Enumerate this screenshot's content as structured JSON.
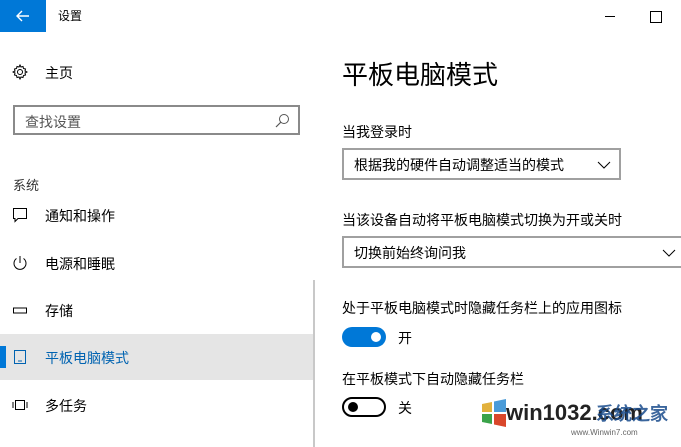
{
  "window": {
    "title": "设置",
    "back_icon": "arrow-left-icon",
    "accent": "#0078d7"
  },
  "sidebar": {
    "home_label": "主页",
    "search_placeholder": "查找设置",
    "section_label": "系统",
    "items": [
      {
        "label": "通知和操作",
        "icon": "notification-icon",
        "selected": false
      },
      {
        "label": "电源和睡眠",
        "icon": "power-icon",
        "selected": false
      },
      {
        "label": "存储",
        "icon": "storage-icon",
        "selected": false
      },
      {
        "label": "平板电脑模式",
        "icon": "tablet-mode-icon",
        "selected": true
      },
      {
        "label": "多任务",
        "icon": "multitasking-icon",
        "selected": false
      }
    ]
  },
  "main": {
    "title": "平板电脑模式",
    "signin_label": "当我登录时",
    "signin_value": "根据我的硬件自动调整适当的模式",
    "auto_switch_label": "当该设备自动将平板电脑模式切换为开或关时",
    "auto_switch_value": "切换前始终询问我",
    "hide_icons_label": "处于平板电脑模式时隐藏任务栏上的应用图标",
    "hide_icons_state": "开",
    "hide_icons_on": true,
    "auto_hide_label": "在平板模式下自动隐藏任务栏",
    "auto_hide_state": "关",
    "auto_hide_on": false
  },
  "watermark": {
    "main_text": "win1032.com",
    "cn_text": "系统之家",
    "sub_text": "www.Winwin7.com"
  }
}
